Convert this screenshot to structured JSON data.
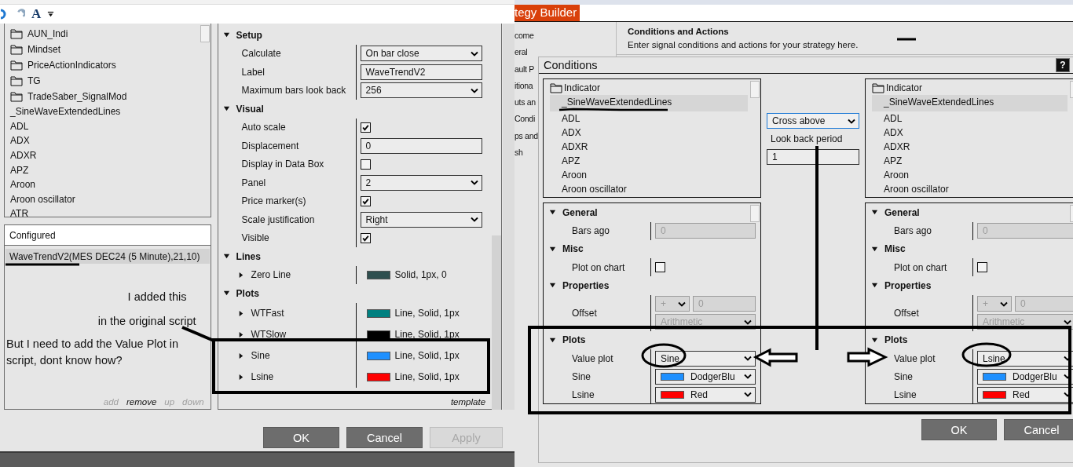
{
  "left_window": {
    "toolbar": {
      "font_button": "A"
    },
    "indicator_list": [
      {
        "kind": "folder",
        "label": "AUN_Indi"
      },
      {
        "kind": "folder",
        "label": "Mindset"
      },
      {
        "kind": "folder",
        "label": "PriceActionIndicators"
      },
      {
        "kind": "folder",
        "label": "TG"
      },
      {
        "kind": "folder",
        "label": "TradeSaber_SignalMod"
      },
      {
        "kind": "item",
        "label": "_SineWaveExtendedLines"
      },
      {
        "kind": "item",
        "label": "ADL"
      },
      {
        "kind": "item",
        "label": "ADX"
      },
      {
        "kind": "item",
        "label": "ADXR"
      },
      {
        "kind": "item",
        "label": "APZ"
      },
      {
        "kind": "item",
        "label": "Aroon"
      },
      {
        "kind": "item",
        "label": "Aroon oscillator"
      },
      {
        "kind": "item",
        "label": "ATR"
      }
    ],
    "configured": {
      "title": "Configured",
      "items": [
        {
          "label": "WaveTrendV2(MES DEC24 (5 Minute),21,10)",
          "selected": true
        }
      ],
      "notes": [
        "I added this",
        "in the original script",
        "But I need to add the Value Plot in script, dont know how?"
      ],
      "actions": [
        {
          "label": "add",
          "disabled": true
        },
        {
          "label": "remove",
          "disabled": false
        },
        {
          "label": "up",
          "disabled": true
        },
        {
          "label": "down",
          "disabled": true
        }
      ]
    },
    "properties": {
      "sections": [
        {
          "title": "Setup",
          "expanded": true,
          "rows": [
            {
              "kind": "dropdown",
              "label": "Calculate",
              "value": "On bar close"
            },
            {
              "kind": "text",
              "label": "Label",
              "value": "WaveTrendV2"
            },
            {
              "kind": "dropdown",
              "label": "Maximum bars look back",
              "value": "256"
            }
          ]
        },
        {
          "title": "Visual",
          "expanded": true,
          "rows": [
            {
              "kind": "checkbox",
              "label": "Auto scale",
              "checked": true
            },
            {
              "kind": "text",
              "label": "Displacement",
              "value": "0"
            },
            {
              "kind": "checkbox",
              "label": "Display in Data Box",
              "checked": false
            },
            {
              "kind": "dropdown",
              "label": "Panel",
              "value": "2"
            },
            {
              "kind": "checkbox",
              "label": "Price marker(s)",
              "checked": true
            },
            {
              "kind": "dropdown",
              "label": "Scale justification",
              "value": "Right"
            },
            {
              "kind": "checkbox",
              "label": "Visible",
              "checked": true
            }
          ]
        },
        {
          "title": "Lines",
          "expanded": true,
          "rows": [
            {
              "kind": "stroke",
              "label": "Zero Line",
              "color": "#2f4f4f",
              "value": "Solid, 1px, 0"
            }
          ]
        },
        {
          "title": "Plots",
          "expanded": true,
          "rows": [
            {
              "kind": "stroke",
              "label": "WTFast",
              "color": "#008080",
              "value": "Line, Solid, 1px"
            },
            {
              "kind": "stroke",
              "label": "WTSlow",
              "color": "#000000",
              "value": "Line, Solid, 1px"
            },
            {
              "kind": "stroke",
              "label": "Sine",
              "color": "#1e90ff",
              "value": "Line, Solid, 1px"
            },
            {
              "kind": "stroke",
              "label": "Lsine",
              "color": "#ff0000",
              "value": "Line, Solid, 1px"
            }
          ]
        }
      ],
      "template_link": "template"
    },
    "buttons": [
      {
        "label": "OK",
        "disabled": false
      },
      {
        "label": "Cancel",
        "disabled": false
      },
      {
        "label": "Apply",
        "disabled": true
      }
    ]
  },
  "right_window": {
    "title_tab": "tegy Builder",
    "nav_items": [
      "come",
      "eral",
      "ault P",
      "itiona",
      "uts an",
      "Condi",
      "ps and",
      "sh"
    ],
    "header": {
      "title": "Conditions and Actions",
      "description": "Enter signal conditions and actions for your strategy here."
    },
    "conditions_dialog": {
      "title": "Conditions",
      "help_button": "?",
      "operands": [
        {
          "list": {
            "folder": "Indicator",
            "items": [
              {
                "label": "_SineWaveExtendedLines",
                "selected": true
              },
              {
                "label": "ADL",
                "selected": false
              },
              {
                "label": "ADX",
                "selected": false
              },
              {
                "label": "ADXR",
                "selected": false
              },
              {
                "label": "APZ",
                "selected": false
              },
              {
                "label": "Aroon",
                "selected": false
              },
              {
                "label": "Aroon oscillator",
                "selected": false
              }
            ]
          },
          "sections": [
            {
              "title": "General",
              "expanded": true,
              "rows": [
                {
                  "kind": "text",
                  "label": "Bars ago",
                  "value": "0",
                  "disabled": true
                }
              ]
            },
            {
              "title": "Misc",
              "expanded": true,
              "rows": [
                {
                  "kind": "checkbox",
                  "label": "Plot on chart",
                  "checked": false
                }
              ]
            },
            {
              "title": "Properties",
              "expanded": true,
              "rows": [
                {
                  "kind": "offset",
                  "label": "Offset",
                  "operator": "+",
                  "value": "0",
                  "mode": "Arithmetic",
                  "disabled": true
                }
              ]
            },
            {
              "title": "Plots",
              "expanded": true,
              "rows": [
                {
                  "kind": "dropdown",
                  "label": "Value plot",
                  "value": "Sine"
                },
                {
                  "kind": "color_dropdown",
                  "label": "Sine",
                  "color": "#1e90ff",
                  "value": "DodgerBlu"
                },
                {
                  "kind": "color_dropdown",
                  "label": "Lsine",
                  "color": "#ff0000",
                  "value": "Red"
                }
              ]
            }
          ]
        },
        {
          "list": {
            "folder": "Indicator",
            "items": [
              {
                "label": "_SineWaveExtendedLines",
                "selected": true
              },
              {
                "label": "ADL",
                "selected": false
              },
              {
                "label": "ADX",
                "selected": false
              },
              {
                "label": "ADXR",
                "selected": false
              },
              {
                "label": "APZ",
                "selected": false
              },
              {
                "label": "Aroon",
                "selected": false
              },
              {
                "label": "Aroon oscillator",
                "selected": false
              }
            ]
          },
          "sections": [
            {
              "title": "General",
              "expanded": true,
              "rows": [
                {
                  "kind": "text",
                  "label": "Bars ago",
                  "value": "0",
                  "disabled": true
                }
              ]
            },
            {
              "title": "Misc",
              "expanded": true,
              "rows": [
                {
                  "kind": "checkbox",
                  "label": "Plot on chart",
                  "checked": false
                }
              ]
            },
            {
              "title": "Properties",
              "expanded": true,
              "rows": [
                {
                  "kind": "offset",
                  "label": "Offset",
                  "operator": "+",
                  "value": "0",
                  "mode": "Arithmetic",
                  "disabled": true
                }
              ]
            },
            {
              "title": "Plots",
              "expanded": true,
              "rows": [
                {
                  "kind": "dropdown",
                  "label": "Value plot",
                  "value": "Lsine"
                },
                {
                  "kind": "color_dropdown",
                  "label": "Sine",
                  "color": "#1e90ff",
                  "value": "DodgerBlu"
                },
                {
                  "kind": "color_dropdown",
                  "label": "Lsine",
                  "color": "#ff0000",
                  "value": "Red"
                }
              ]
            }
          ]
        }
      ],
      "operator": {
        "value": "Cross above"
      },
      "look_back": {
        "label": "Look back period",
        "value": "1"
      },
      "buttons": [
        {
          "label": "OK",
          "disabled": false
        },
        {
          "label": "Cancel",
          "disabled": false
        }
      ]
    }
  }
}
